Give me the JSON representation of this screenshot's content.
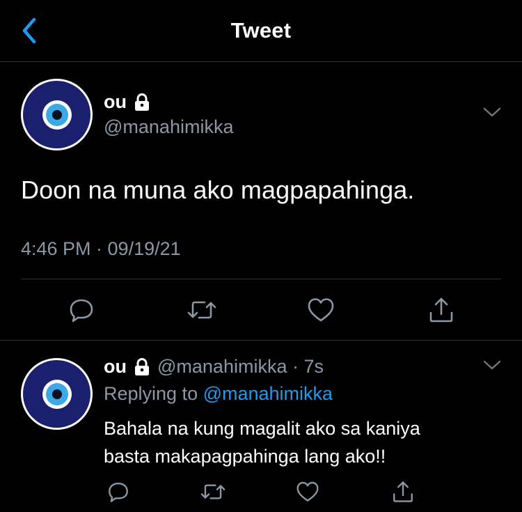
{
  "header": {
    "title": "Tweet",
    "back_icon": "chevron-left-icon",
    "accent_color": "#1d9bf0"
  },
  "main_tweet": {
    "display_name": "ou",
    "locked": true,
    "handle": "@manahimikka",
    "text": "Doon na muna ako magpapahinga.",
    "timestamp": "4:46 PM · 09/19/21",
    "actions": [
      "reply-icon",
      "retweet-icon",
      "like-icon",
      "share-icon"
    ]
  },
  "reply_tweet": {
    "display_name": "ou",
    "locked": true,
    "handle_time": "@manahimikka · 7s",
    "replying_prefix": "Replying to ",
    "replying_to": "@manahimikka",
    "text_line1": "Bahala na kung magalit ako sa kaniya",
    "text_line2": "basta makapagpahinga lang ako!!",
    "actions": [
      "reply-icon",
      "retweet-icon",
      "like-icon",
      "share-icon"
    ]
  },
  "colors": {
    "background": "#000000",
    "secondary_text": "#8b98a5",
    "divider": "#2f3336",
    "link": "#1d9bf0"
  }
}
